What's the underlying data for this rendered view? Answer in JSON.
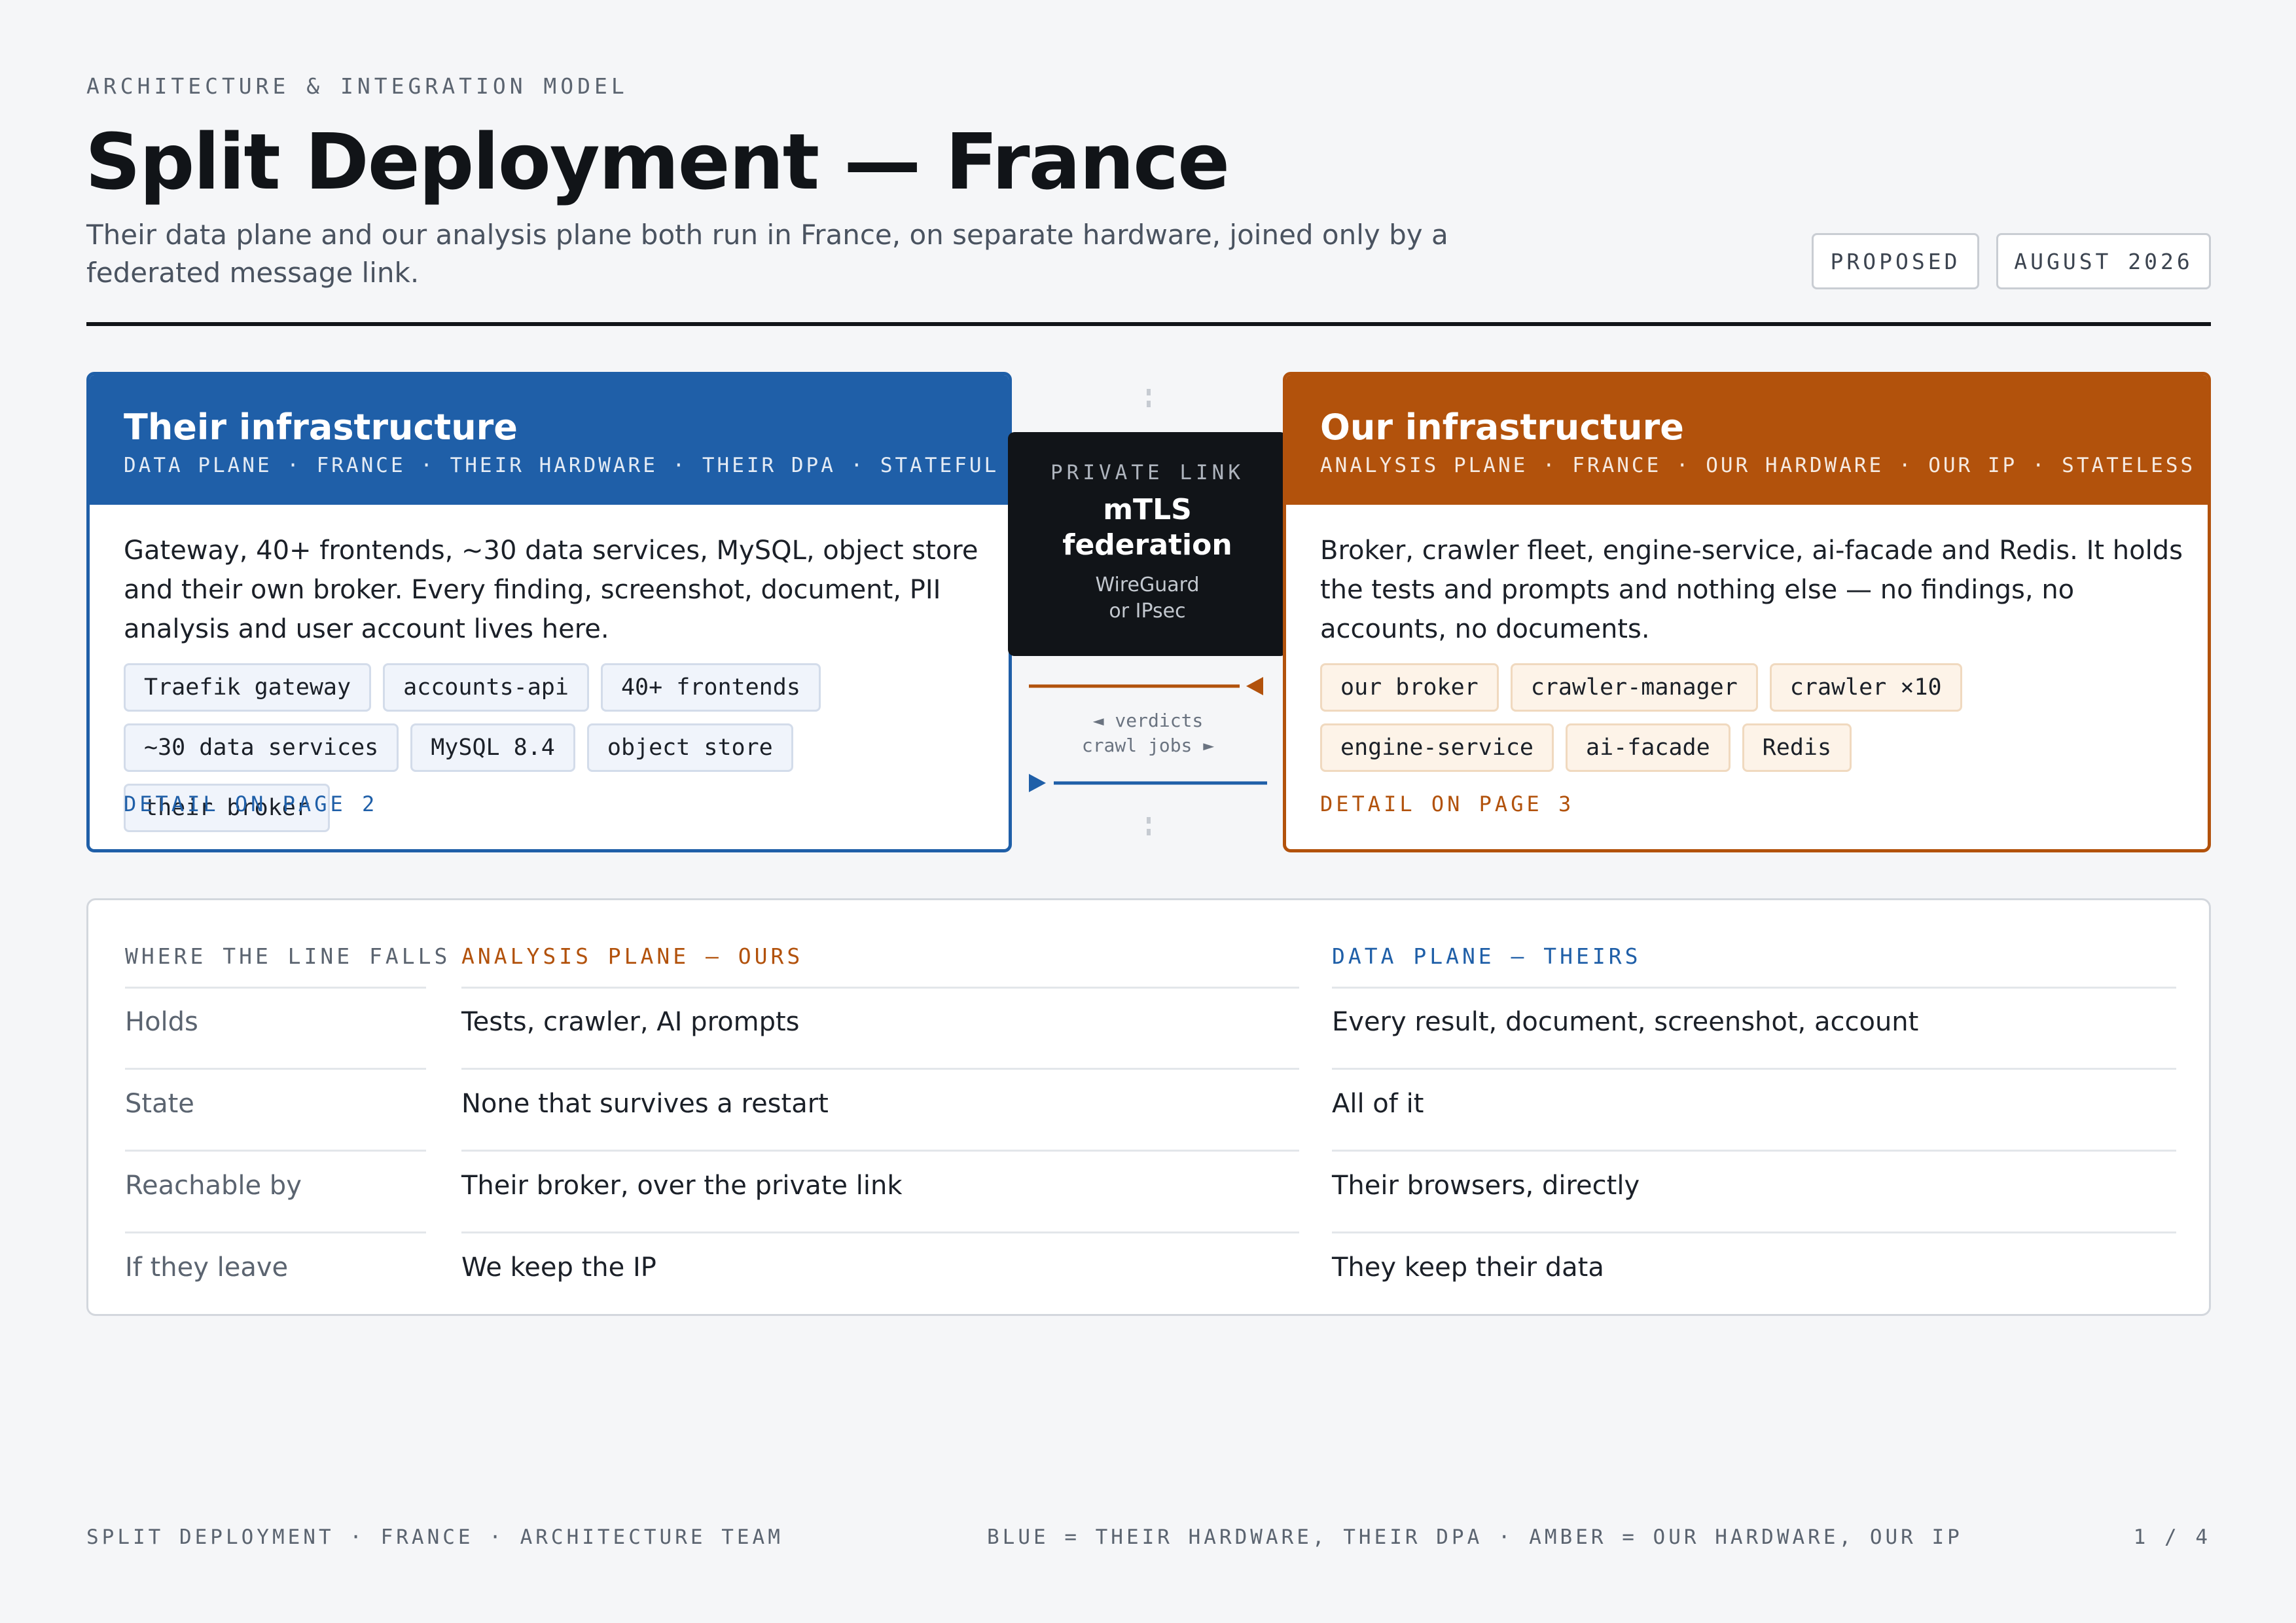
{
  "header": {
    "eyebrow": "ARCHITECTURE & INTEGRATION MODEL",
    "title": "Split Deployment — France",
    "subtitle": "Their data plane and our analysis plane both run in France, on separate hardware, joined only by a federated message link.",
    "badges": [
      "PROPOSED",
      "AUGUST 2026"
    ]
  },
  "theirs": {
    "title": "Their infrastructure",
    "meta": "DATA PLANE · FRANCE · THEIR HARDWARE · THEIR DPA · STATEFUL",
    "description": "Gateway, 40+ frontends, ~30 data services, MySQL, object store and their own broker. Every finding, screenshot, document, PII analysis and user account lives here.",
    "chips": [
      "Traefik gateway",
      "accounts-api",
      "40+ frontends",
      "~30 data services",
      "MySQL 8.4",
      "object store",
      "their broker"
    ],
    "link": "DETAIL ON PAGE 2",
    "color": "#1f5fa8"
  },
  "ours": {
    "title": "Our infrastructure",
    "meta": "ANALYSIS PLANE · FRANCE · OUR HARDWARE · OUR IP · STATELESS",
    "description": "Broker, crawler fleet, engine-service, ai-facade and Redis. It holds the tests and prompts and nothing else — no findings, no accounts, no documents.",
    "chips": [
      "our broker",
      "crawler-manager",
      "crawler ×10",
      "engine-service",
      "ai-facade",
      "Redis"
    ],
    "link": "DETAIL ON PAGE 3",
    "color": "#b2520c"
  },
  "link": {
    "label": "PRIVATE LINK",
    "title_line1": "mTLS",
    "title_line2": "federation",
    "note_line1": "WireGuard",
    "note_line2": "or IPsec",
    "flow_in": "◄ verdicts",
    "flow_out": "crawl jobs ►"
  },
  "table": {
    "headers": [
      "WHERE THE LINE FALLS",
      "ANALYSIS PLANE — OURS",
      "DATA PLANE — THEIRS"
    ],
    "rows": [
      {
        "label": "Holds",
        "ours": "Tests, crawler, AI prompts",
        "theirs": "Every result, document, screenshot, account"
      },
      {
        "label": "State",
        "ours": "None that survives a restart",
        "theirs": "All of it"
      },
      {
        "label": "Reachable by",
        "ours": "Their broker, over the private link",
        "theirs": "Their browsers, directly"
      },
      {
        "label": "If they leave",
        "ours": "We keep the IP",
        "theirs": "They keep their data"
      }
    ]
  },
  "footer": {
    "left": "SPLIT DEPLOYMENT · FRANCE · ARCHITECTURE TEAM",
    "center": "BLUE = THEIR HARDWARE, THEIR DPA · AMBER = OUR HARDWARE, OUR IP",
    "right": "1 / 4"
  }
}
